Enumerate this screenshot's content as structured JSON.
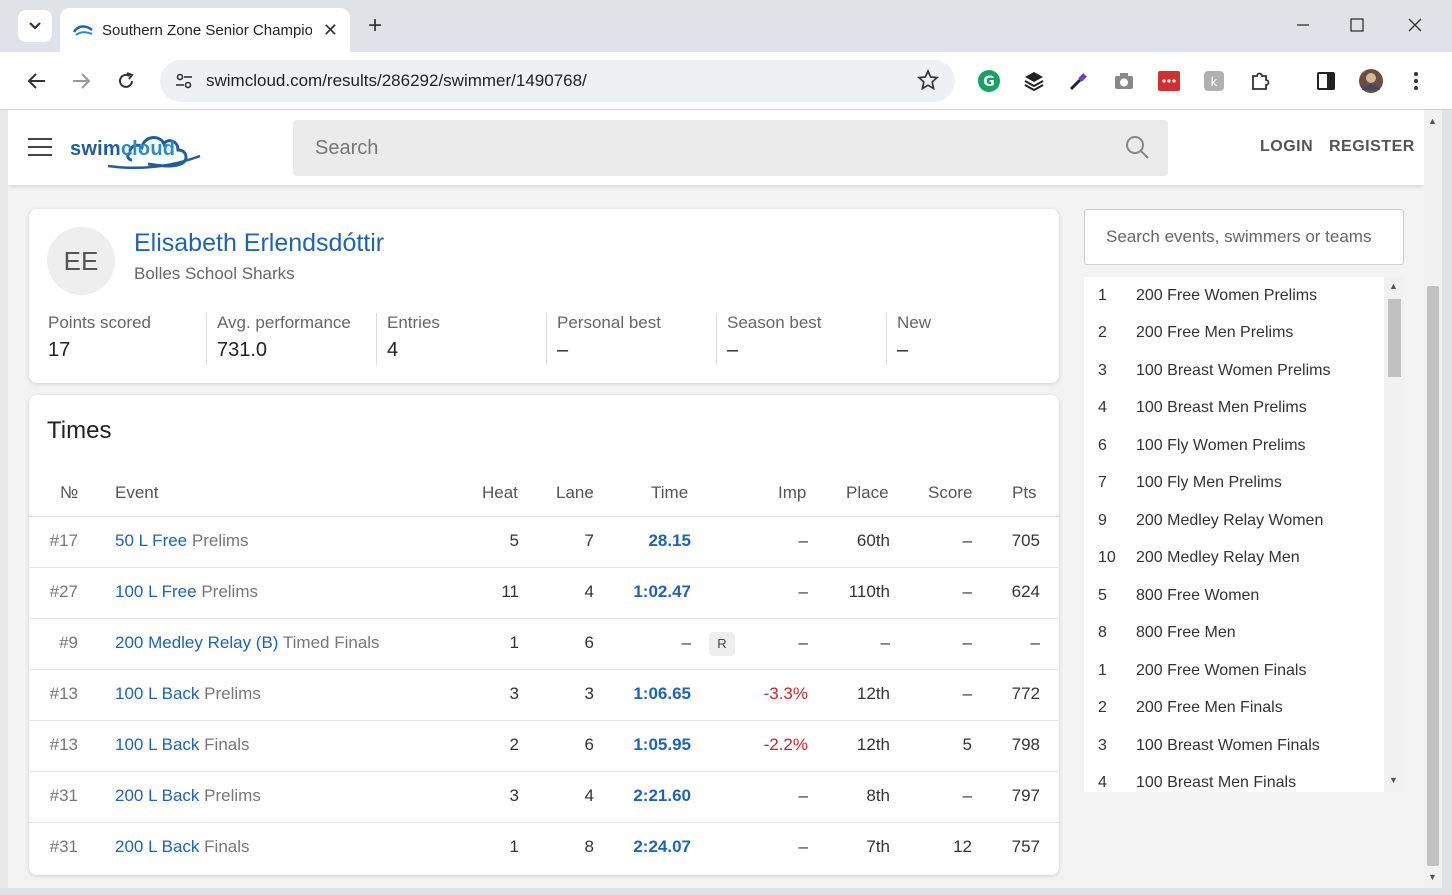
{
  "browser": {
    "tab_title": "Southern Zone Senior Champio",
    "url": "swimcloud.com/results/286292/swimmer/1490768/"
  },
  "site": {
    "search_placeholder": "Search",
    "login": "LOGIN",
    "register": "REGISTER"
  },
  "profile": {
    "initials": "EE",
    "name": "Elisabeth Erlendsdóttir",
    "team": "Bolles School Sharks",
    "stats": [
      {
        "label": "Points scored",
        "value": "17"
      },
      {
        "label": "Avg. performance",
        "value": "731.0"
      },
      {
        "label": "Entries",
        "value": "4"
      },
      {
        "label": "Personal best",
        "value": "–"
      },
      {
        "label": "Season best",
        "value": "–"
      },
      {
        "label": "New",
        "value": "–"
      }
    ]
  },
  "times": {
    "title": "Times",
    "headers": {
      "no": "№",
      "event": "Event",
      "heat": "Heat",
      "lane": "Lane",
      "time": "Time",
      "imp": "Imp",
      "place": "Place",
      "score": "Score",
      "pts": "Pts"
    },
    "rows": [
      {
        "no": "#17",
        "event": "50 L Free",
        "round": "Prelims",
        "heat": "5",
        "lane": "7",
        "time": "28.15",
        "imp": "–",
        "place": "60th",
        "score": "–",
        "pts": "705"
      },
      {
        "no": "#27",
        "event": "100 L Free",
        "round": "Prelims",
        "heat": "11",
        "lane": "4",
        "time": "1:02.47",
        "imp": "–",
        "place": "110th",
        "score": "–",
        "pts": "624"
      },
      {
        "no": "#9",
        "event": "200 Medley Relay (B)",
        "round": "Timed Finals",
        "heat": "1",
        "lane": "6",
        "time": "–",
        "badge": "R",
        "imp": "–",
        "place": "–",
        "score": "–",
        "pts": "–"
      },
      {
        "no": "#13",
        "event": "100 L Back",
        "round": "Prelims",
        "heat": "3",
        "lane": "3",
        "time": "1:06.65",
        "imp": "-3.3%",
        "place": "12th",
        "score": "–",
        "pts": "772"
      },
      {
        "no": "#13",
        "event": "100 L Back",
        "round": "Finals",
        "heat": "2",
        "lane": "6",
        "time": "1:05.95",
        "imp": "-2.2%",
        "place": "12th",
        "score": "5",
        "pts": "798"
      },
      {
        "no": "#31",
        "event": "200 L Back",
        "round": "Prelims",
        "heat": "3",
        "lane": "4",
        "time": "2:21.60",
        "imp": "–",
        "place": "8th",
        "score": "–",
        "pts": "797"
      },
      {
        "no": "#31",
        "event": "200 L Back",
        "round": "Finals",
        "heat": "1",
        "lane": "8",
        "time": "2:24.07",
        "imp": "–",
        "place": "7th",
        "score": "12",
        "pts": "757"
      }
    ]
  },
  "events_panel": {
    "search_placeholder": "Search events, swimmers or teams",
    "items": [
      {
        "num": "1",
        "name": "200 Free Women Prelims"
      },
      {
        "num": "2",
        "name": "200 Free Men Prelims"
      },
      {
        "num": "3",
        "name": "100 Breast Women Prelims"
      },
      {
        "num": "4",
        "name": "100 Breast Men Prelims"
      },
      {
        "num": "6",
        "name": "100 Fly Women Prelims"
      },
      {
        "num": "7",
        "name": "100 Fly Men Prelims"
      },
      {
        "num": "9",
        "name": "200 Medley Relay Women"
      },
      {
        "num": "10",
        "name": "200 Medley Relay Men"
      },
      {
        "num": "5",
        "name": "800 Free Women"
      },
      {
        "num": "8",
        "name": "800 Free Men"
      },
      {
        "num": "1",
        "name": "200 Free Women Finals"
      },
      {
        "num": "2",
        "name": "200 Free Men Finals"
      },
      {
        "num": "3",
        "name": "100 Breast Women Finals"
      },
      {
        "num": "4",
        "name": "100 Breast Men Finals"
      }
    ]
  },
  "colors": {
    "link": "#1f63b5",
    "negative": "#c62828"
  },
  "logo": {
    "word_a": "swim",
    "word_b": "cloud"
  }
}
